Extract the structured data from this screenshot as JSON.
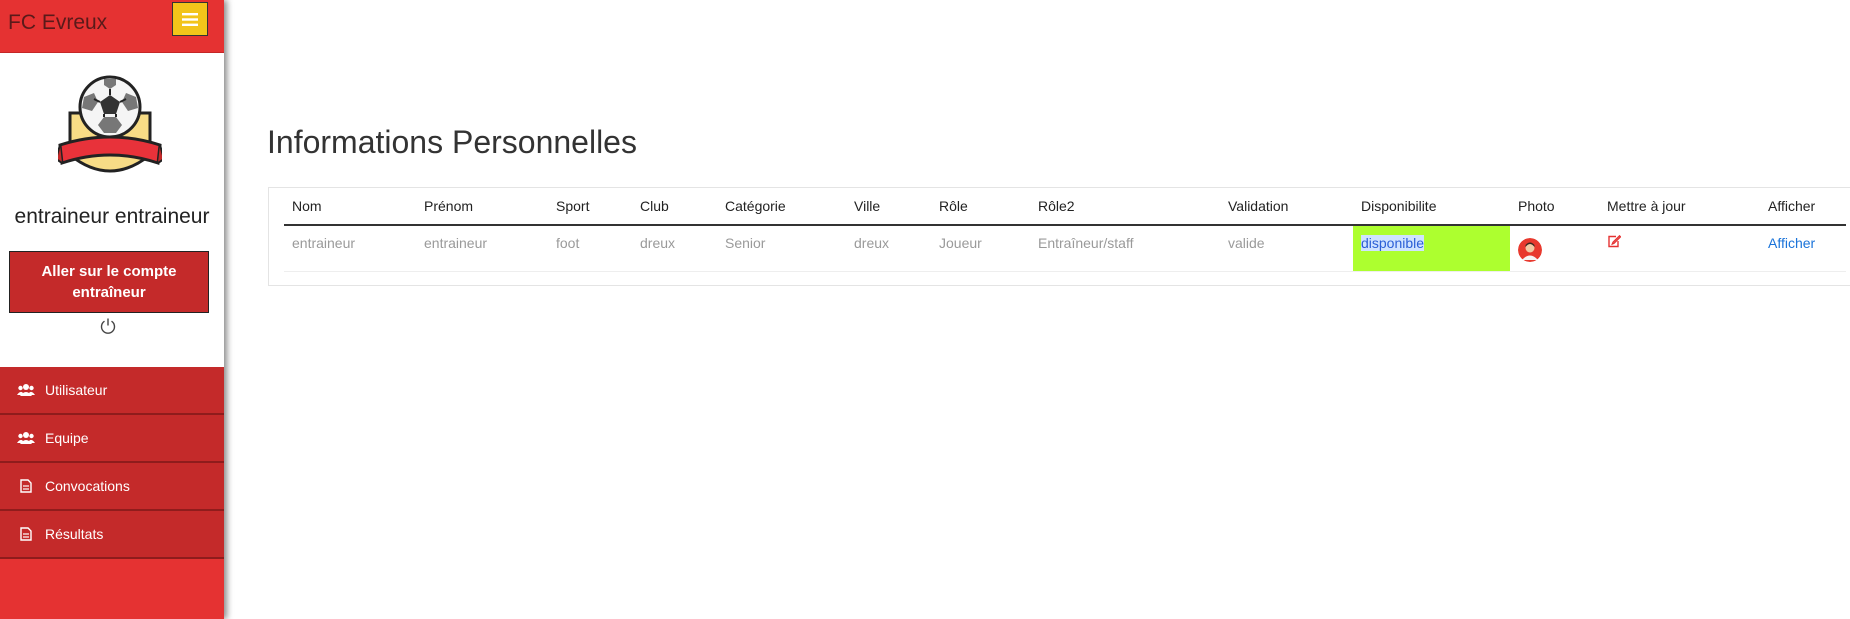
{
  "app": {
    "brand": "FC Evreux"
  },
  "sidebar": {
    "user_name": "entraineur entraineur",
    "account_button": "Aller sur le compte entraîneur",
    "items": [
      {
        "label": "Utilisateur",
        "icon": "users-icon"
      },
      {
        "label": "Equipe",
        "icon": "users-icon"
      },
      {
        "label": "Convocations",
        "icon": "document-icon"
      },
      {
        "label": "Résultats",
        "icon": "document-icon"
      }
    ]
  },
  "main": {
    "title": "Informations Personnelles",
    "table": {
      "headers": [
        "Nom",
        "Prénom",
        "Sport",
        "Club",
        "Catégorie",
        "Ville",
        "Rôle",
        "Rôle2",
        "Validation",
        "Disponibilite",
        "Photo",
        "Mettre à jour",
        "Afficher"
      ],
      "row": {
        "nom": "entraineur",
        "prenom": "entraineur",
        "sport": "foot",
        "club": "dreux",
        "categorie": "Senior",
        "ville": "dreux",
        "role": "Joueur",
        "role2": "Entraîneur/staff",
        "validation": "valide",
        "disponibilite": "disponible",
        "photo_icon": "avatar-icon",
        "update_icon": "edit-icon",
        "afficher": "Afficher"
      }
    }
  },
  "colors": {
    "sidebar_red": "#e53232",
    "nav_red": "#c42a2a",
    "toggle_yellow": "#f2c41a",
    "available_green": "#adff2f",
    "link_blue": "#1a73d9"
  }
}
